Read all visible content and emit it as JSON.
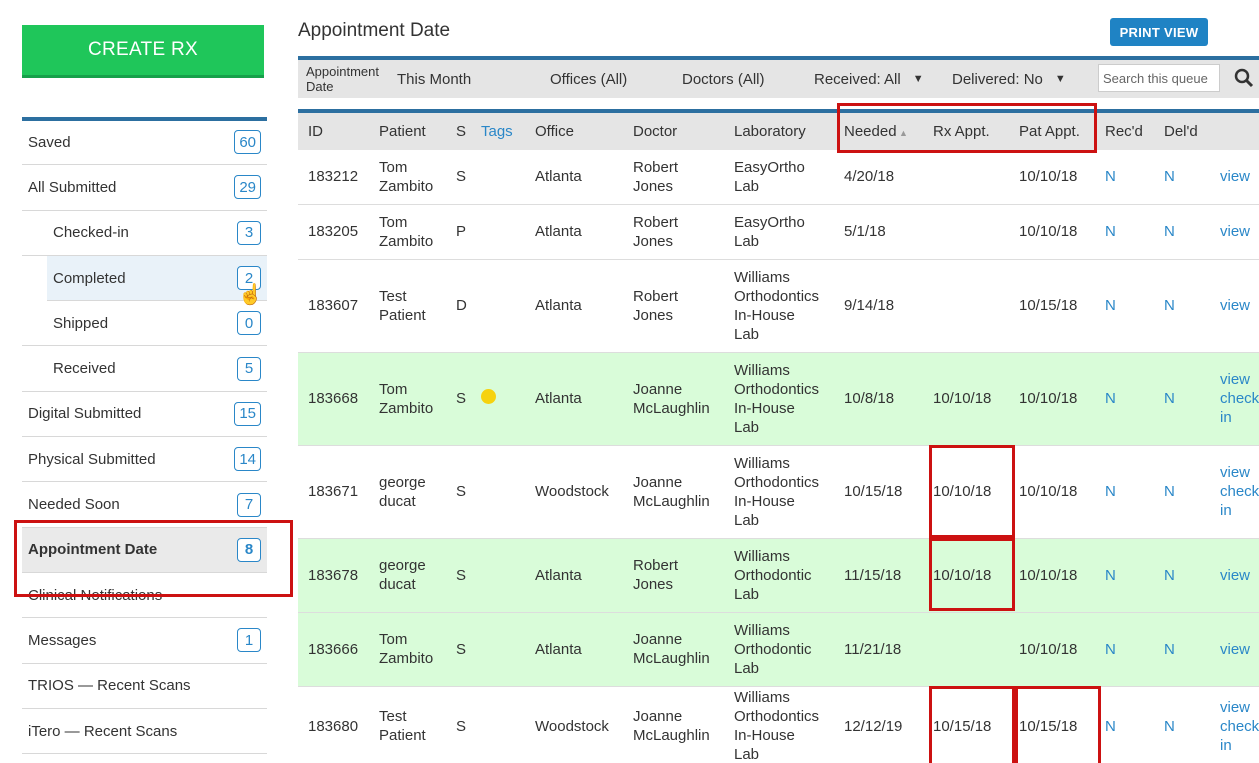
{
  "sidebar": {
    "create_label": "CREATE RX",
    "items": [
      {
        "label": "Saved",
        "count": "60",
        "sub": false
      },
      {
        "label": "All Submitted",
        "count": "29",
        "sub": false
      },
      {
        "label": "Checked-in",
        "count": "3",
        "sub": true
      },
      {
        "label": "Completed",
        "count": "2",
        "sub": true
      },
      {
        "label": "Shipped",
        "count": "0",
        "sub": true
      },
      {
        "label": "Received",
        "count": "5",
        "sub": true
      },
      {
        "label": "Digital Submitted",
        "count": "15",
        "sub": false
      },
      {
        "label": "Physical Submitted",
        "count": "14",
        "sub": false
      },
      {
        "label": "Needed Soon",
        "count": "7",
        "sub": false
      },
      {
        "label": "Appointment Date",
        "count": "8",
        "sub": false
      },
      {
        "label": "Clinical Notifications",
        "count": "",
        "sub": false
      },
      {
        "label": "Messages",
        "count": "1",
        "sub": false
      },
      {
        "label": "TRIOS — Recent Scans",
        "count": "",
        "sub": false
      },
      {
        "label": "iTero — Recent Scans",
        "count": "",
        "sub": false
      }
    ]
  },
  "header": {
    "title": "Appointment Date",
    "print_label": "PRINT VIEW"
  },
  "filters": {
    "appt_label_1": "Appointment",
    "appt_label_2": "Date",
    "appt_value": "This Month",
    "offices": "Offices (All)",
    "doctors": "Doctors (All)",
    "received": "Received: All",
    "delivered": "Delivered: No",
    "search_placeholder": "Search this queue"
  },
  "table": {
    "columns": [
      "ID",
      "Patient",
      "S",
      "Tags",
      "Office",
      "Doctor",
      "Laboratory",
      "Needed",
      "Rx Appt.",
      "Pat Appt.",
      "Rec'd",
      "Del'd",
      ""
    ],
    "rows": [
      {
        "id": "183212",
        "patient": [
          "Tom",
          "Zambito"
        ],
        "s": "S",
        "tag": false,
        "office": "Atlanta",
        "doctor": [
          "Robert",
          "Jones"
        ],
        "lab": [
          "EasyOrtho",
          "Lab"
        ],
        "needed": "4/20/18",
        "rx": "",
        "pat": "10/10/18",
        "rec": "N",
        "del": "N",
        "action": [
          "view"
        ],
        "green": false
      },
      {
        "id": "183205",
        "patient": [
          "Tom",
          "Zambito"
        ],
        "s": "P",
        "tag": false,
        "office": "Atlanta",
        "doctor": [
          "Robert",
          "Jones"
        ],
        "lab": [
          "EasyOrtho",
          "Lab"
        ],
        "needed": "5/1/18",
        "rx": "",
        "pat": "10/10/18",
        "rec": "N",
        "del": "N",
        "action": [
          "view"
        ],
        "green": false
      },
      {
        "id": "183607",
        "patient": [
          "Test",
          "Patient"
        ],
        "s": "D",
        "tag": false,
        "office": "Atlanta",
        "doctor": [
          "Robert",
          "Jones"
        ],
        "lab": [
          "Williams",
          "Orthodontics",
          "In-House",
          "Lab"
        ],
        "needed": "9/14/18",
        "rx": "",
        "pat": "10/15/18",
        "rec": "N",
        "del": "N",
        "action": [
          "view"
        ],
        "green": false
      },
      {
        "id": "183668",
        "patient": [
          "Tom",
          "Zambito"
        ],
        "s": "S",
        "tag": true,
        "office": "Atlanta",
        "doctor": [
          "Joanne",
          "McLaughlin"
        ],
        "lab": [
          "Williams",
          "Orthodontics",
          "In-House",
          "Lab"
        ],
        "needed": "10/8/18",
        "rx": "10/10/18",
        "pat": "10/10/18",
        "rec": "N",
        "del": "N",
        "action": [
          "view",
          "check",
          "in"
        ],
        "green": true
      },
      {
        "id": "183671",
        "patient": [
          "george",
          "ducat"
        ],
        "s": "S",
        "tag": false,
        "office": "Woodstock",
        "doctor": [
          "Joanne",
          "McLaughlin"
        ],
        "lab": [
          "Williams",
          "Orthodontics",
          "In-House",
          "Lab"
        ],
        "needed": "10/15/18",
        "rx": "10/10/18",
        "pat": "10/10/18",
        "rec": "N",
        "del": "N",
        "action": [
          "view",
          "check",
          "in"
        ],
        "green": false
      },
      {
        "id": "183678",
        "patient": [
          "george",
          "ducat"
        ],
        "s": "S",
        "tag": false,
        "office": "Atlanta",
        "doctor": [
          "Robert",
          "Jones"
        ],
        "lab": [
          "Williams",
          "Orthodontic",
          "Lab"
        ],
        "needed": "11/15/18",
        "rx": "10/10/18",
        "pat": "10/10/18",
        "rec": "N",
        "del": "N",
        "action": [
          "view"
        ],
        "green": true
      },
      {
        "id": "183666",
        "patient": [
          "Tom",
          "Zambito"
        ],
        "s": "S",
        "tag": false,
        "office": "Atlanta",
        "doctor": [
          "Joanne",
          "McLaughlin"
        ],
        "lab": [
          "Williams",
          "Orthodontic",
          "Lab"
        ],
        "needed": "11/21/18",
        "rx": "",
        "pat": "10/10/18",
        "rec": "N",
        "del": "N",
        "action": [
          "view"
        ],
        "green": true
      },
      {
        "id": "183680",
        "patient": [
          "Test",
          "Patient"
        ],
        "s": "S",
        "tag": false,
        "office": "Woodstock",
        "doctor": [
          "Joanne",
          "McLaughlin"
        ],
        "lab": [
          "Williams",
          "Orthodontics",
          "In-House",
          "Lab"
        ],
        "needed": "12/12/19",
        "rx": "10/15/18",
        "pat": "10/15/18",
        "rec": "N",
        "del": "N",
        "action": [
          "view",
          "check",
          "in"
        ],
        "green": false
      }
    ]
  },
  "colors": {
    "accent": "#2a87c8",
    "create_green": "#1fc65a",
    "row_green": "#d9fcd9",
    "highlight_red": "#cc1111",
    "tag_yellow": "#f6d20f"
  }
}
